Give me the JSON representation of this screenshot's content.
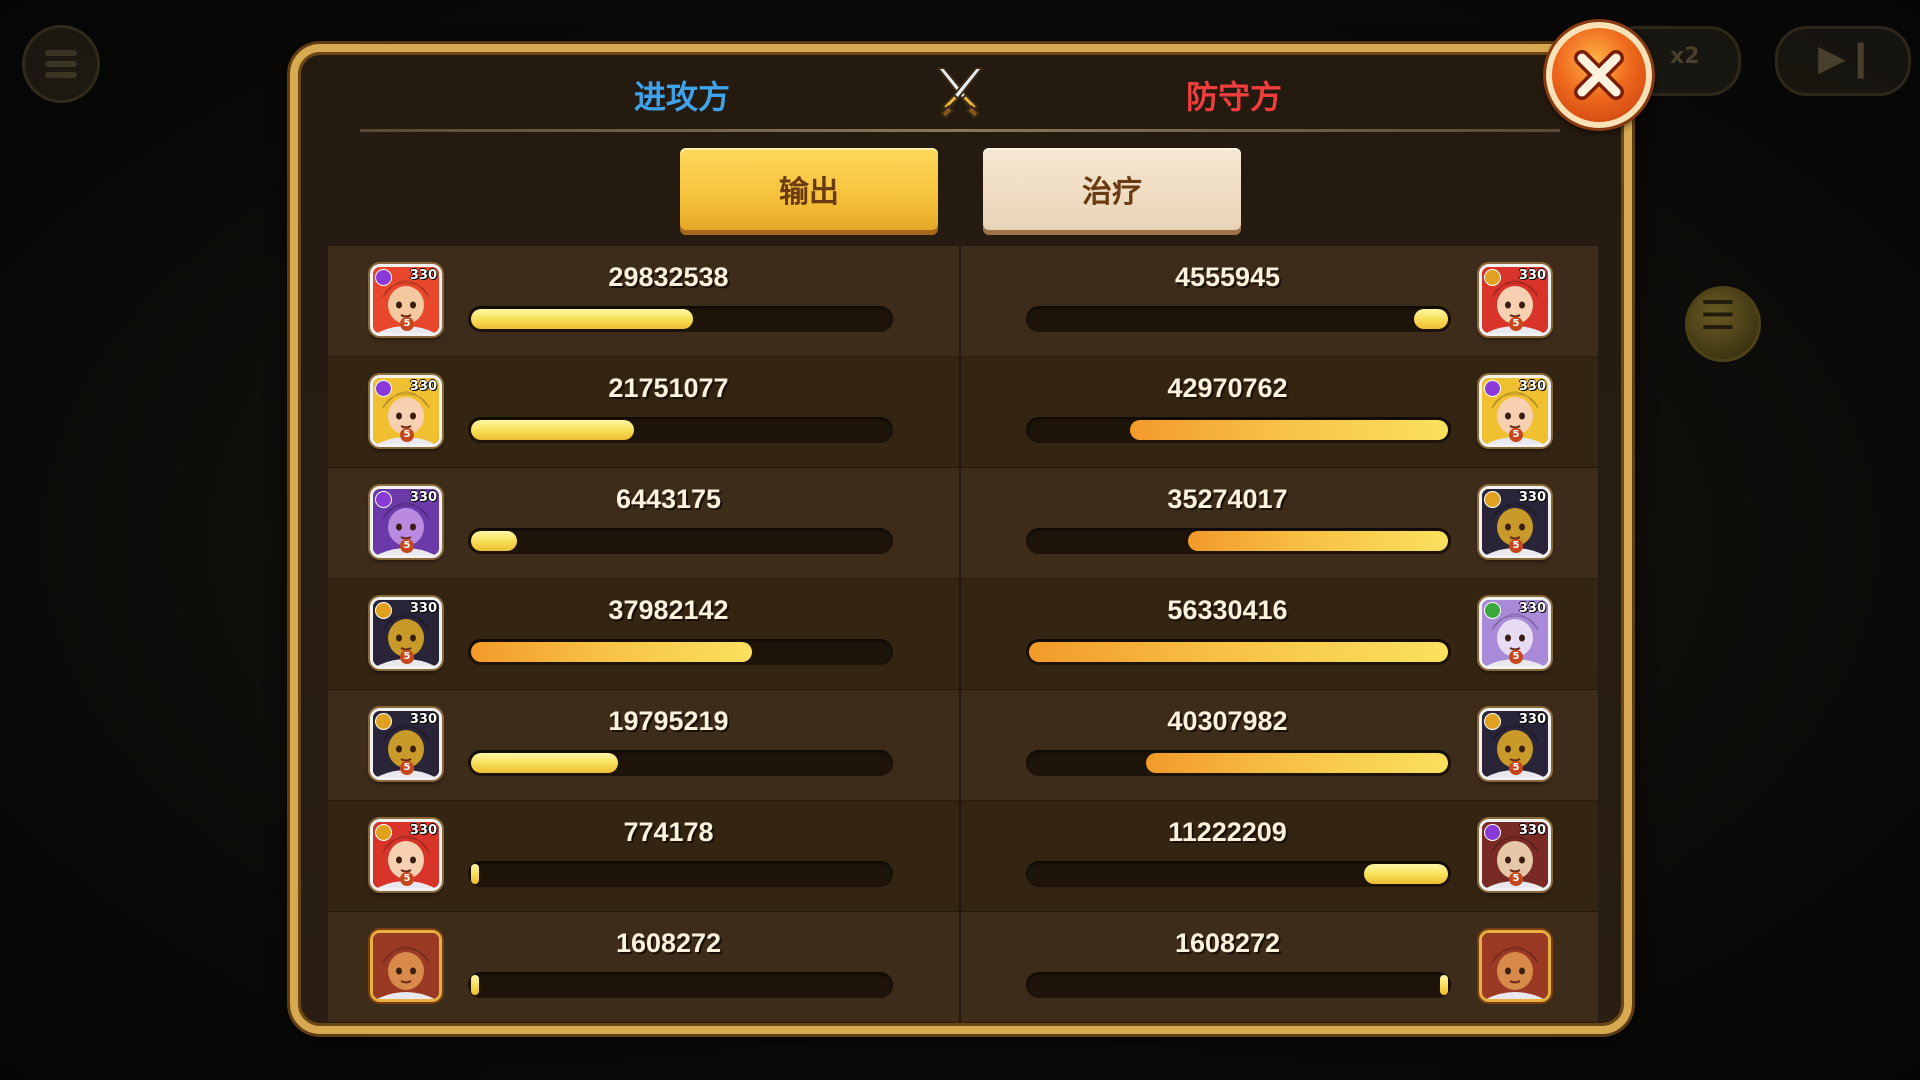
{
  "hud": {
    "speed_label": "x2"
  },
  "header": {
    "attacker_label": "进攻方",
    "defender_label": "防守方"
  },
  "tabs": {
    "output_label": "输出",
    "heal_label": "治疗",
    "active": "output"
  },
  "rows": [
    {
      "attacker": {
        "value": "29832538",
        "level": "330",
        "stars": "5",
        "fill": 0.53,
        "portrait": "red-haired hero",
        "element": "purple"
      },
      "defender": {
        "value": "4555945",
        "level": "330",
        "stars": "5",
        "fill": 0.08,
        "portrait": "red-haired heroine",
        "element": "gold"
      }
    },
    {
      "attacker": {
        "value": "21751077",
        "level": "330",
        "stars": "5",
        "fill": 0.39,
        "portrait": "blonde heroine",
        "element": "purple"
      },
      "defender": {
        "value": "42970762",
        "level": "330",
        "stars": "5",
        "fill": 0.76,
        "portrait": "blonde heroine",
        "element": "purple"
      }
    },
    {
      "attacker": {
        "value": "6443175",
        "level": "330",
        "stars": "5",
        "fill": 0.11,
        "portrait": "purple dragon",
        "element": "purple"
      },
      "defender": {
        "value": "35274017",
        "level": "330",
        "stars": "5",
        "fill": 0.62,
        "portrait": "dark knight",
        "element": "gold"
      }
    },
    {
      "attacker": {
        "value": "37982142",
        "level": "330",
        "stars": "5",
        "fill": 0.67,
        "portrait": "dark knight",
        "element": "gold"
      },
      "defender": {
        "value": "56330416",
        "level": "330",
        "stars": "5",
        "fill": 1.0,
        "portrait": "spirit maiden",
        "element": "green"
      }
    },
    {
      "attacker": {
        "value": "19795219",
        "level": "330",
        "stars": "5",
        "fill": 0.35,
        "portrait": "dark knight",
        "element": "gold"
      },
      "defender": {
        "value": "40307982",
        "level": "330",
        "stars": "5",
        "fill": 0.72,
        "portrait": "dark knight",
        "element": "gold"
      }
    },
    {
      "attacker": {
        "value": "774178",
        "level": "330",
        "stars": "5",
        "fill": 0.01,
        "portrait": "red-haired heroine",
        "element": "gold"
      },
      "defender": {
        "value": "11222209",
        "level": "330",
        "stars": "5",
        "fill": 0.2,
        "portrait": "hooded warrior",
        "element": "purple"
      }
    },
    {
      "attacker": {
        "value": "1608272",
        "level": "",
        "stars": "",
        "fill": 0.02,
        "portrait": "boar beast",
        "element": ""
      },
      "defender": {
        "value": "1608272",
        "level": "",
        "stars": "",
        "fill": 0.02,
        "portrait": "boar beast",
        "element": ""
      }
    }
  ],
  "icons": {
    "header": "crossed-swords-icon",
    "close": "close-icon",
    "menu": "menu-icon",
    "play": "play-pause-icon",
    "list": "list-icon"
  },
  "colors": {
    "attacker": "#3ea3ea",
    "defender": "#f13d3d",
    "accent": "#f6c23c",
    "panel_border": "#d7aa52"
  }
}
